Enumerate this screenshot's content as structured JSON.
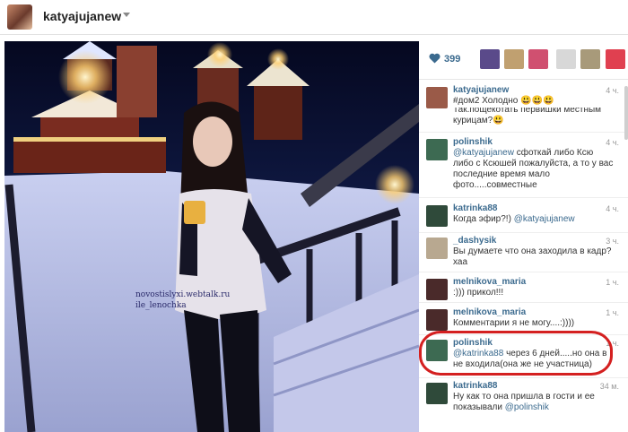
{
  "header": {
    "username": "katyajujanew"
  },
  "photo": {
    "watermark_lines": [
      "novostislyxi.webtalk.ru",
      "ile_lenochka"
    ]
  },
  "likes": {
    "count": "399",
    "liker_colors": [
      "#5a4a8a",
      "#c0a070",
      "#d05070",
      "#d8d8d8",
      "#a89a7a",
      "#e04050"
    ]
  },
  "comments": [
    {
      "user": "katyajujanew",
      "time": "4 ч.",
      "text": "#дом2 Холодно 😃😃😃",
      "avatar": "#9a5a48"
    },
    {
      "user": "",
      "time": "",
      "text": "Так.пощекотать первишки местным курицам?😃",
      "avatar": ""
    },
    {
      "user": "polinshik",
      "time": "4 ч.",
      "mention": "@katyajujanew",
      "text": " сфоткай либо Ксю либо с Ксюшей пожалуйста, а то у вас последние время мало фото.....совместные",
      "avatar": "#3d6a52"
    },
    {
      "user": "katrinka88",
      "time": "4 ч.",
      "text": "Когда эфир?!) ",
      "mention_after": "@katyajujanew",
      "avatar": "#2f4a3a"
    },
    {
      "user": "_dashysik",
      "time": "3 ч.",
      "text": "Вы думаете что она заходила в кадр?хаа",
      "avatar": "#b8a890"
    },
    {
      "user": "melnikova_maria",
      "time": "1 ч.",
      "text": ":))) прикол!!!",
      "avatar": "#4a2a2a"
    },
    {
      "user": "melnikova_maria",
      "time": "1 ч.",
      "text": "Комментарии я не могу....:))))",
      "avatar": "#4a2a2a"
    },
    {
      "user": "polinshik",
      "time": "1 ч.",
      "mention": "@katrinka88",
      "text": " через 6 дней.....но она в не входила(она же не участница)",
      "avatar": "#3d6a52"
    },
    {
      "user": "katrinka88",
      "time": "34 м.",
      "text": "Ну как то она пришла в гости и ее показывали ",
      "mention_after": "@polinshik",
      "avatar": "#2f4a3a"
    }
  ]
}
